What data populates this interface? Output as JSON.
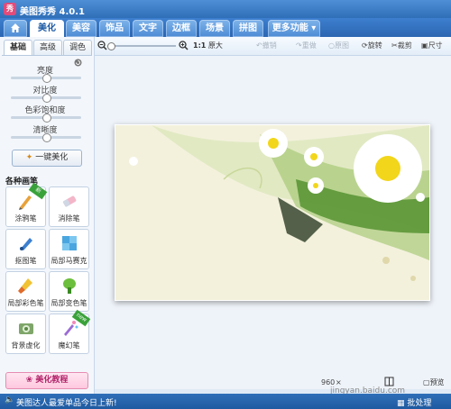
{
  "app": {
    "title": "美图秀秀 4.0.1",
    "logo_text": "秀"
  },
  "menu": {
    "home_icon": "home-icon",
    "tabs": [
      {
        "label": "美化",
        "active": true
      },
      {
        "label": "美容",
        "active": false
      },
      {
        "label": "饰品",
        "active": false
      },
      {
        "label": "文字",
        "active": false
      },
      {
        "label": "边框",
        "active": false
      },
      {
        "label": "场景",
        "active": false
      },
      {
        "label": "拼图",
        "active": false
      },
      {
        "label": "更多功能 ▾",
        "active": false
      }
    ]
  },
  "left_panel": {
    "subtabs": [
      "基础",
      "高级",
      "调色"
    ],
    "sliders": [
      {
        "label": "亮度",
        "value": 0.5
      },
      {
        "label": "对比度",
        "value": 0.5
      },
      {
        "label": "色彩饱和度",
        "value": 0.5
      },
      {
        "label": "清晰度",
        "value": 0.5
      }
    ],
    "one_click_label": "一键美化",
    "brush_header": "各种画笔",
    "brushes": [
      {
        "label": "涂鸦笔",
        "badge": "新"
      },
      {
        "label": "消除笔",
        "badge": ""
      },
      {
        "label": "抠图笔",
        "badge": ""
      },
      {
        "label": "局部马赛克",
        "badge": ""
      },
      {
        "label": "局部彩色笔",
        "badge": ""
      },
      {
        "label": "局部变色笔",
        "badge": ""
      },
      {
        "label": "背景虚化",
        "badge": ""
      },
      {
        "label": "魔幻笔",
        "badge": "new"
      }
    ],
    "tutorial_label": "美化教程"
  },
  "toolbar": {
    "zoom_ratio": "1:1",
    "original_size": "原大",
    "undo": "撤销",
    "redo": "重做",
    "original": "原图",
    "rotate": "旋转",
    "crop": "裁剪",
    "resize": "尺寸"
  },
  "image_info": {
    "width": "960",
    "times": "×",
    "preview": "预览",
    "batch": "批处理"
  },
  "status": {
    "message": "美图达人最爱单品今日上新!"
  },
  "watermark": "jingyan.baidu.com",
  "colors": {
    "accent": "#2f6fb8",
    "active_tab_text": "#1d5aa4",
    "tutorial": "#b1246a"
  }
}
